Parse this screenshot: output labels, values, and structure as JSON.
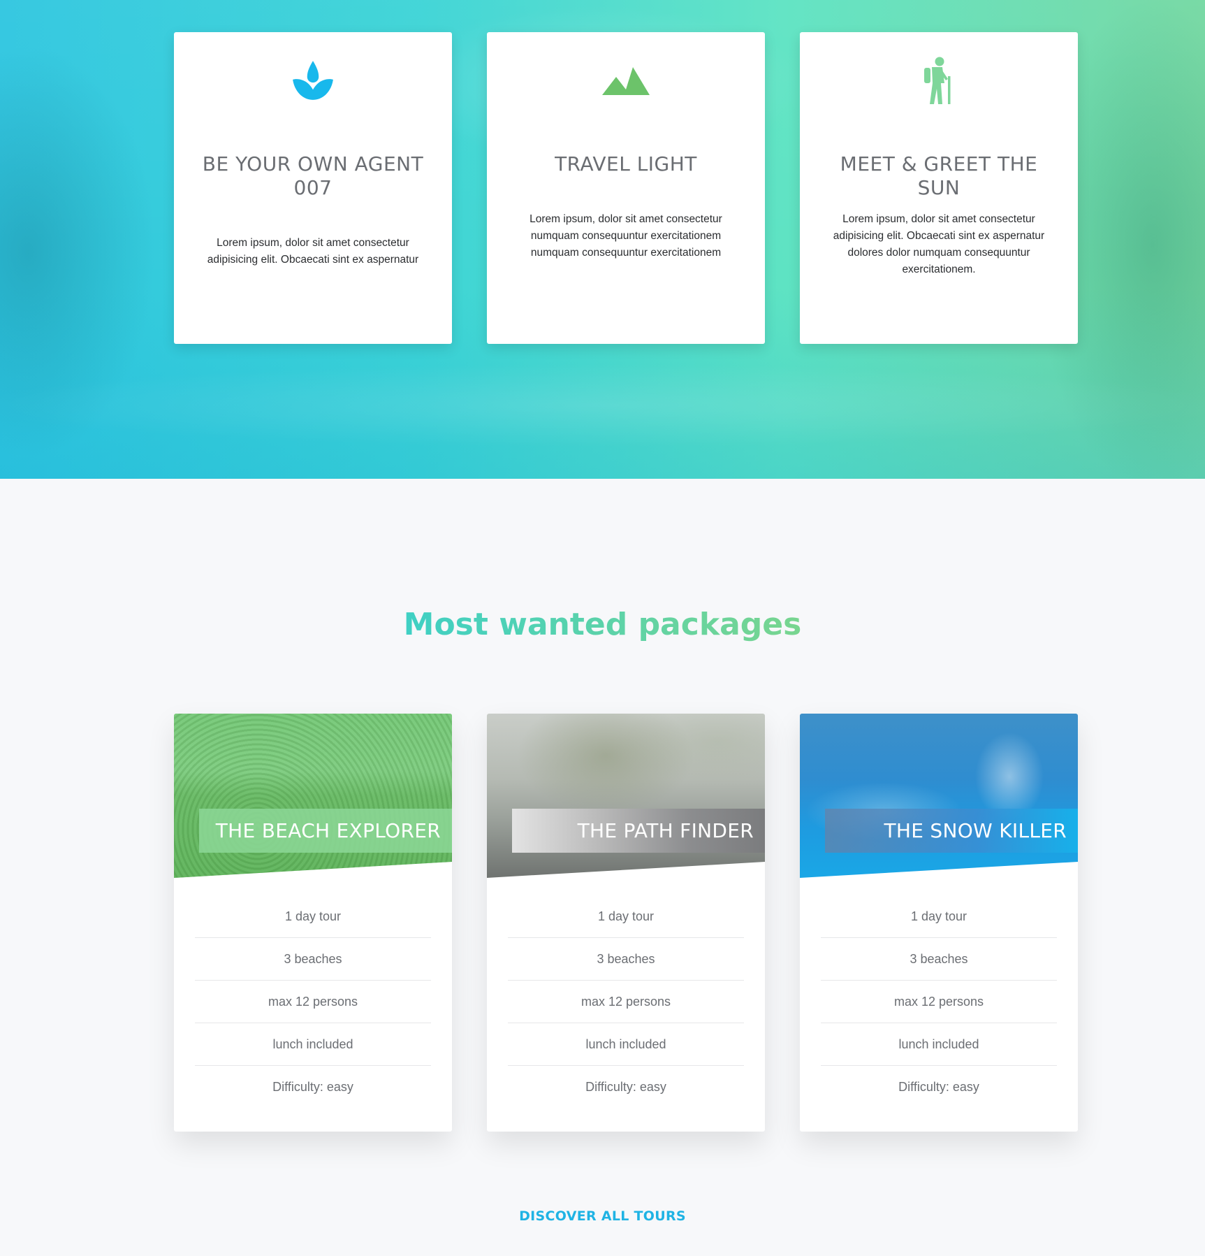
{
  "features": [
    {
      "icon": "lotus-icon",
      "title": "BE YOUR OWN AGENT 007",
      "text": "Lorem ipsum, dolor sit amet consectetur adipisicing elit. Obcaecati sint ex aspernatur"
    },
    {
      "icon": "mountains-icon",
      "title": "TRAVEL LIGHT",
      "text": "Lorem ipsum, dolor sit amet consectetur numquam consequuntur exercitationem numquam consequuntur exercitationem"
    },
    {
      "icon": "hiker-icon",
      "title": "MEET & GREET THE SUN",
      "text": "Lorem ipsum, dolor sit amet consectetur adipisicing elit. Obcaecati sint ex aspernatur dolores dolor numquam consequuntur exercitationem."
    }
  ],
  "packages_section": {
    "title": "Most wanted packages"
  },
  "packages": [
    {
      "name": "THE BEACH EXPLORER",
      "features": [
        "1 day tour",
        "3 beaches",
        "max 12 persons",
        "lunch included",
        "Difficulty: easy"
      ]
    },
    {
      "name": "THE PATH FINDER",
      "features": [
        "1 day tour",
        "3 beaches",
        "max 12 persons",
        "lunch included",
        "Difficulty: easy"
      ]
    },
    {
      "name": "THE SNOW KILLER",
      "features": [
        "1 day tour",
        "3 beaches",
        "max 12 persons",
        "lunch included",
        "Difficulty: easy"
      ]
    }
  ],
  "cta": {
    "label": "DISCOVER ALL TOURS"
  },
  "colors": {
    "accent_blue": "#1fb3e4",
    "accent_green": "#6cc36a",
    "accent_light_green": "#7fd69a"
  }
}
